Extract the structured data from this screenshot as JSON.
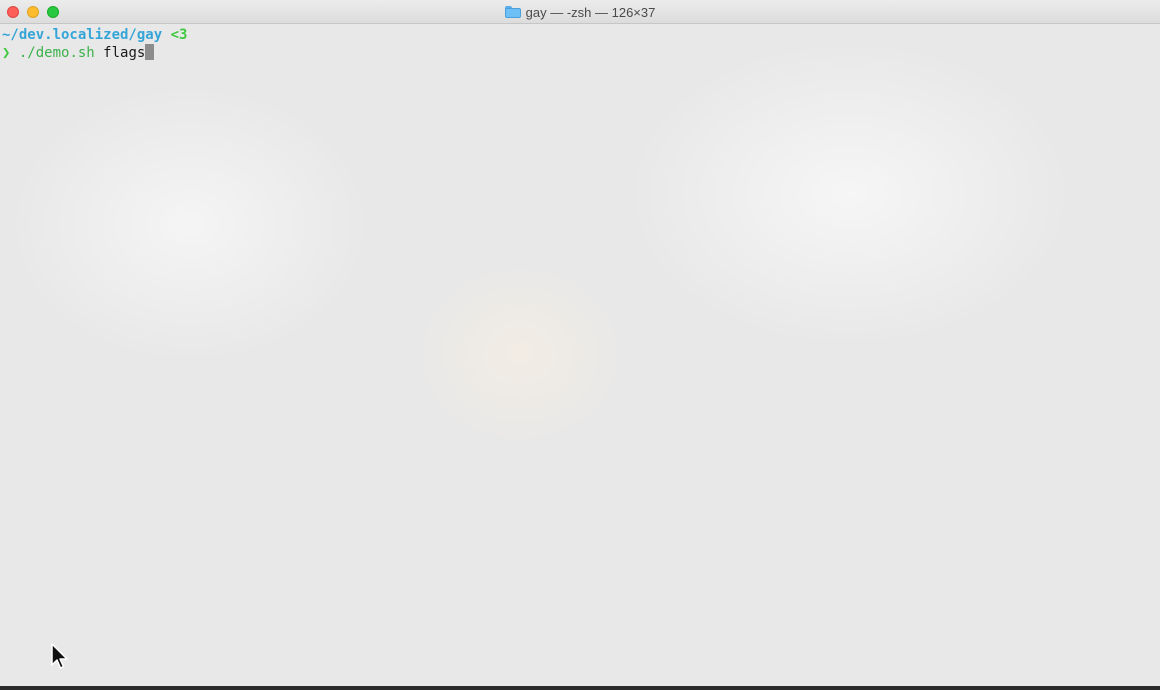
{
  "window": {
    "title": "gay — -zsh — 126×37"
  },
  "terminal": {
    "prompt_path": "~/dev.localized/gay",
    "prompt_suffix": "<3",
    "prompt_symbol": "❯",
    "command": "./demo.sh",
    "argument": "flags"
  },
  "colors": {
    "path": "#35a5d8",
    "prompt_symbol": "#3ec93e",
    "command": "#3bb24a"
  },
  "icons": {
    "title_icon": "folder-icon",
    "pointer": "mouse-pointer-icon"
  }
}
